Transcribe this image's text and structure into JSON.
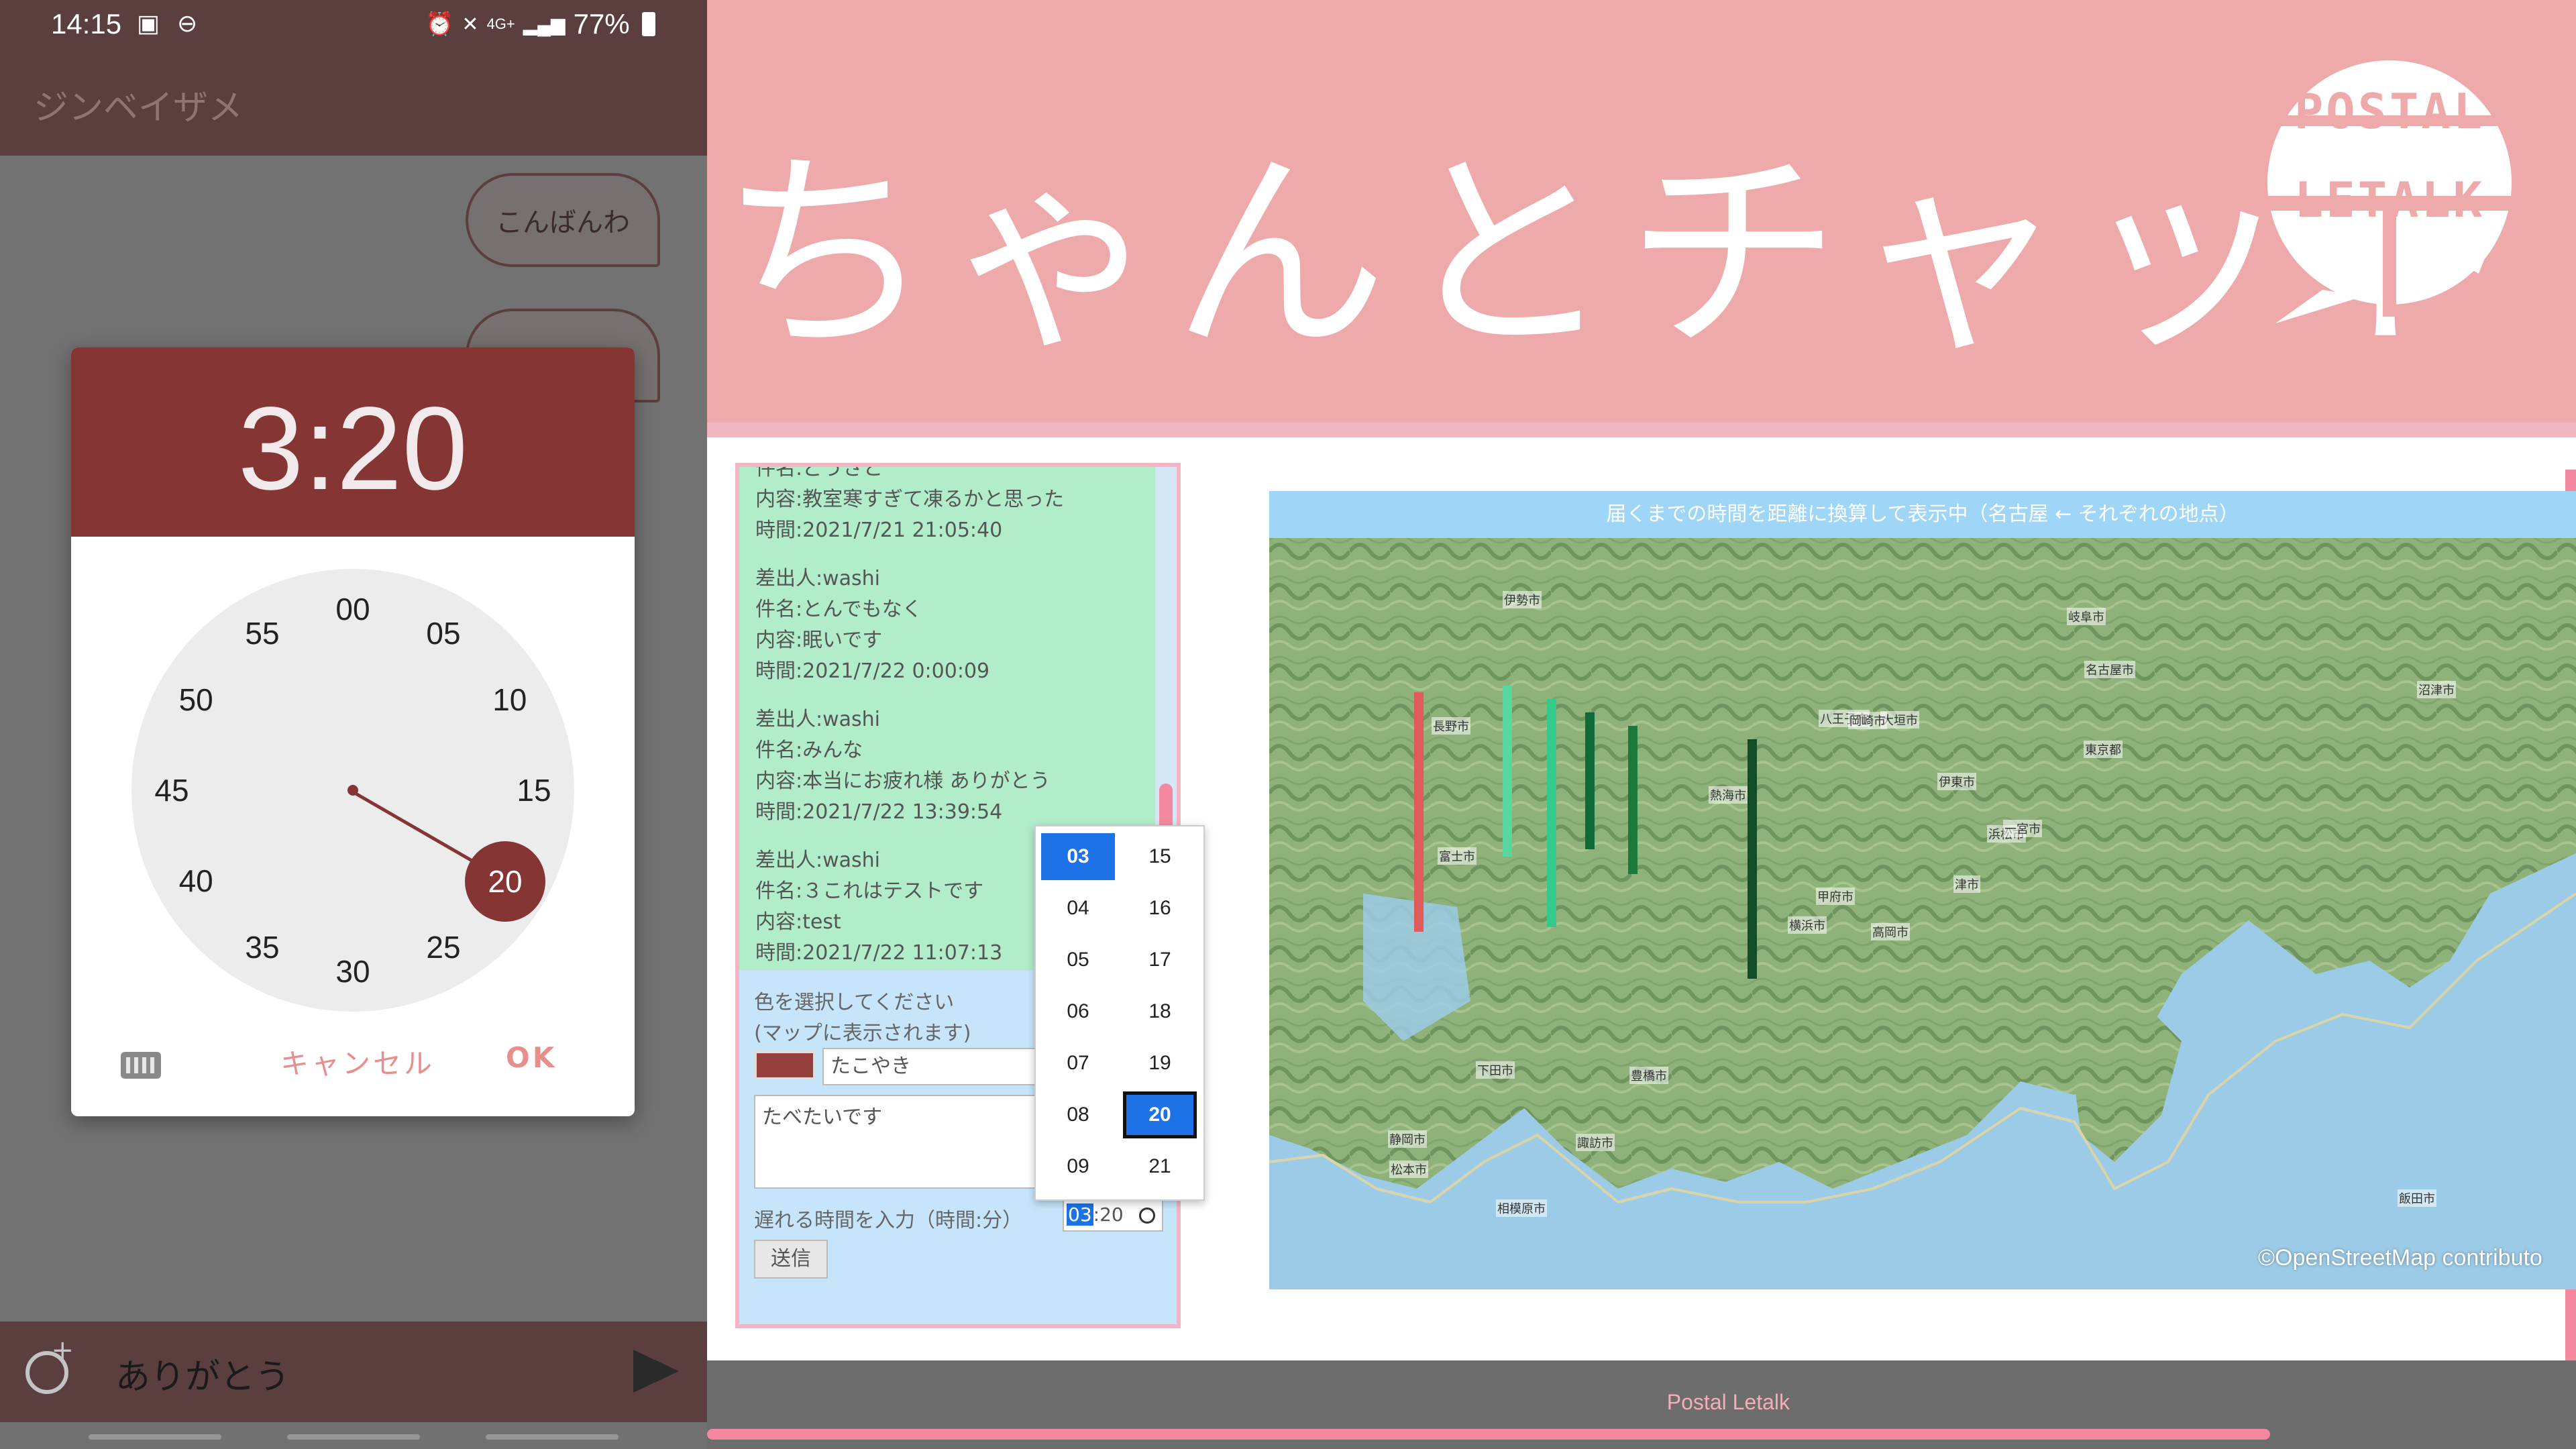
{
  "phone": {
    "status": {
      "time": "14:15",
      "battery": "77%",
      "network": "4G+"
    },
    "app_title": "ジンベイザメ",
    "bubbles": [
      "こんばんわ",
      ""
    ],
    "dialog": {
      "time_display": "3:20",
      "clock_numbers": [
        "00",
        "05",
        "10",
        "15",
        "20",
        "25",
        "30",
        "35",
        "40",
        "45",
        "50",
        "55"
      ],
      "selected": "20",
      "cancel_label": "キャンセル",
      "ok_label": "OK"
    },
    "message_input": "ありがとう",
    "icons": {
      "schedule": "schedule-add-icon",
      "send": "send-icon",
      "keyboard": "keyboard-icon"
    }
  },
  "banner": {
    "title": "ちゃんとチャット",
    "logo_line1": "POSTAL",
    "logo_line2": "LETALK"
  },
  "webapp": {
    "messages": [
      {
        "lines": [
          "件名:どうさと",
          "内容:教室寒すぎて凍るかと思った",
          "時間:2021/7/21 21:05:40"
        ]
      },
      {
        "lines": [
          "差出人:washi",
          "件名:とんでもなく",
          "内容:眠いです",
          "時間:2021/7/22 0:00:09"
        ]
      },
      {
        "lines": [
          "差出人:washi",
          "件名:みんな",
          "内容:本当にお疲れ様 ありがとう",
          "時間:2021/7/22 13:39:54"
        ]
      },
      {
        "lines": [
          "差出人:washi",
          "件名:３これはテストです",
          "内容:test",
          "時間:2021/7/22 11:07:13"
        ]
      }
    ],
    "color_label_1": "色を選択してください",
    "color_label_2": "(マップに表示されます)",
    "selected_color": "#943e3e",
    "title_value": "たこやき",
    "content_value": "たべたいです",
    "delay_label": "遅れる時間を入力（時間:分）",
    "time_hour": "03",
    "time_minute": ":20",
    "send_label": "送信",
    "dropdown": {
      "hours": [
        "03",
        "04",
        "05",
        "06",
        "07",
        "08",
        "09"
      ],
      "minutes": [
        "15",
        "16",
        "17",
        "18",
        "19",
        "20",
        "21"
      ],
      "selected_hour": "03",
      "selected_minute": "20"
    },
    "map": {
      "title": "届くまでの時間を距離に換算して表示中（名古屋 ← それぞれの地点）",
      "attribution": "©OpenStreetMap contributo",
      "bars": [
        {
          "color": "#e05a5a",
          "value": 0.42
        },
        {
          "color": "#5ad6a0",
          "value": 0.3
        },
        {
          "color": "#35c98a",
          "value": 0.4
        },
        {
          "color": "#0f6a38",
          "value": 0.24
        },
        {
          "color": "#1b7a3a",
          "value": 0.26
        },
        {
          "color": "#124d26",
          "value": 0.42
        }
      ],
      "towns": [
        "高岡市",
        "長野市",
        "甲府市",
        "静岡市",
        "浜松市",
        "豊橋市",
        "岐阜市",
        "大垣市",
        "名古屋市",
        "津市",
        "伊勢市",
        "飯田市",
        "富士市",
        "沼津市",
        "横浜市",
        "東京都",
        "相模原市",
        "八王子市",
        "伊東市",
        "下田市",
        "熱海市",
        "松本市",
        "諏訪市",
        "岡崎市",
        "一宮市"
      ]
    },
    "footer": "Postal Letalk"
  }
}
